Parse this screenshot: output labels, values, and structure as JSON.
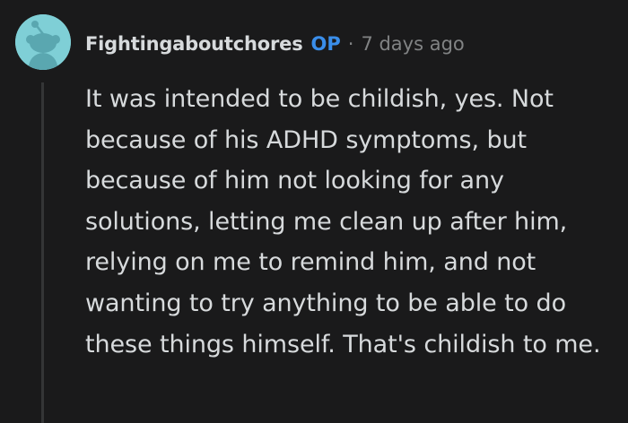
{
  "comment": {
    "author": "Fightingaboutchores",
    "badge": "OP",
    "separator": "·",
    "timestamp": "7 days ago",
    "body": "It was intended to be childish, yes. Not because of his ADHD symptoms, but because of him not looking for any solutions, letting me clean up after him, relying on me to remind him, and not wanting to try anything to be able to do these things himself. That's childish to me."
  },
  "avatar": {
    "icon": "snoo-avatar-icon",
    "background_color": "#7fcfd6",
    "figure_color": "#5aa7b0"
  },
  "colors": {
    "background": "#1a1a1b",
    "text": "#d7dadc",
    "muted": "#818384",
    "op_badge": "#3a8eea",
    "thread_line": "#343536"
  }
}
